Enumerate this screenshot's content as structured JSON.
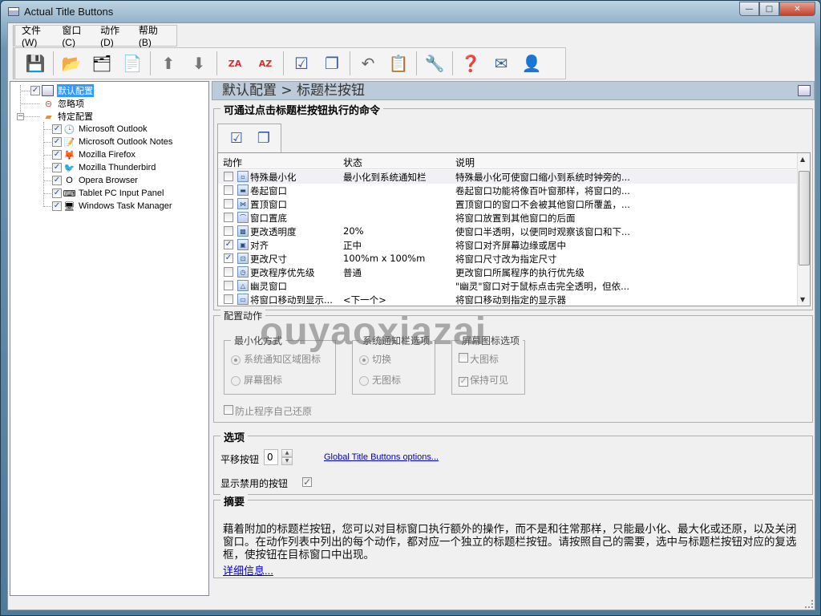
{
  "window": {
    "title": "Actual Title Buttons",
    "controls": {
      "minimize": "—",
      "maximize": "□",
      "close": "✕"
    }
  },
  "menu": [
    {
      "label": "文件(W)"
    },
    {
      "label": "窗口(C)"
    },
    {
      "label": "动作(D)"
    },
    {
      "label": "帮助(B)"
    }
  ],
  "toolbar": [
    {
      "name": "save",
      "icon": "floppy-disk-icon",
      "glyph": "💾"
    },
    {
      "name": "add-window",
      "icon": "add-window-icon",
      "glyph": "📂"
    },
    {
      "name": "remove-window",
      "icon": "remove-window-icon",
      "glyph": "🗂"
    },
    {
      "name": "copy",
      "icon": "copy-icon",
      "glyph": "📄"
    },
    {
      "name": "move-up",
      "icon": "arrow-up-icon",
      "glyph": "⬆"
    },
    {
      "name": "move-down",
      "icon": "arrow-down-icon",
      "glyph": "⬇"
    },
    {
      "name": "sort-za",
      "icon": "sort-za-icon",
      "glyph": "ZA"
    },
    {
      "name": "sort-az",
      "icon": "sort-az-icon",
      "glyph": "AZ"
    },
    {
      "name": "check-all",
      "icon": "check-windows-icon",
      "glyph": "☑"
    },
    {
      "name": "windows",
      "icon": "windows-icon",
      "glyph": "❐"
    },
    {
      "name": "undo",
      "icon": "undo-icon",
      "glyph": "↶"
    },
    {
      "name": "export",
      "icon": "export-icon",
      "glyph": "📋"
    },
    {
      "name": "settings",
      "icon": "tools-icon",
      "glyph": "🔧"
    },
    {
      "name": "help",
      "icon": "help-icon",
      "glyph": "❓"
    },
    {
      "name": "mail",
      "icon": "mail-icon",
      "glyph": "✉"
    },
    {
      "name": "support",
      "icon": "support-icon",
      "glyph": "👤"
    }
  ],
  "tree": {
    "root": [
      {
        "label": "默认配置",
        "checked": true,
        "selected": true
      },
      {
        "label": "忽略项"
      },
      {
        "label": "特定配置",
        "expanded": true
      }
    ],
    "children": [
      {
        "label": "Microsoft Outlook",
        "checked": true,
        "glyph": "🕒"
      },
      {
        "label": "Microsoft Outlook Notes",
        "checked": true,
        "glyph": "📝"
      },
      {
        "label": "Mozilla Firefox",
        "checked": true,
        "glyph": "🦊"
      },
      {
        "label": "Mozilla Thunderbird",
        "checked": true,
        "glyph": "🐦"
      },
      {
        "label": "Opera Browser",
        "checked": true,
        "glyph": "O"
      },
      {
        "label": "Tablet PC Input Panel",
        "checked": true,
        "glyph": "⌨"
      },
      {
        "label": "Windows Task Manager",
        "checked": true,
        "glyph": "🖥"
      }
    ],
    "check_mark": "✓",
    "expander": "−"
  },
  "breadcrumb": "默认配置 > 标题栏按钮",
  "commands": {
    "title": "可通过点击标题栏按钮执行的命令",
    "columns": [
      "动作",
      "状态",
      "说明"
    ],
    "rows": [
      {
        "checked": false,
        "icon": "▫",
        "action": "特殊最小化",
        "status": "最小化到系统通知栏",
        "desc": "特殊最小化可使窗口缩小到系统时钟旁的..."
      },
      {
        "checked": false,
        "icon": "▬",
        "action": "卷起窗口",
        "status": "",
        "desc": "卷起窗口功能将像百叶窗那样，将窗口的..."
      },
      {
        "checked": false,
        "icon": "⋈",
        "action": "置顶窗口",
        "status": "",
        "desc": "置顶窗口的窗口不会被其他窗口所覆盖，..."
      },
      {
        "checked": false,
        "icon": "⌒",
        "action": "窗口置底",
        "status": "",
        "desc": "将窗口放置到其他窗口的后面"
      },
      {
        "checked": false,
        "icon": "▩",
        "action": "更改透明度",
        "status": "20%",
        "desc": "使窗口半透明，以便同时观察该窗口和下..."
      },
      {
        "checked": true,
        "icon": "▣",
        "action": "对齐",
        "status": "正中",
        "desc": "将窗口对齐屏幕边缘或居中"
      },
      {
        "checked": true,
        "icon": "⊡",
        "action": "更改尺寸",
        "status": "100%m x 100%m",
        "desc": "将窗口尺寸改为指定尺寸"
      },
      {
        "checked": false,
        "icon": "◷",
        "action": "更改程序优先级",
        "status": "普通",
        "desc": "更改窗口所属程序的执行优先级"
      },
      {
        "checked": false,
        "icon": "△",
        "action": "幽灵窗口",
        "status": "",
        "desc": "\"幽灵\"窗口对于鼠标点击完全透明，但依..."
      },
      {
        "checked": false,
        "icon": "▭",
        "action": "将窗口移动到显示...",
        "status": "<下一个>",
        "desc": "将窗口移动到指定的显示器"
      }
    ]
  },
  "config": {
    "title": "配置动作",
    "minimize_mode": {
      "title": "最小化方式",
      "options": [
        {
          "label": "系统通知区域图标",
          "selected": true
        },
        {
          "label": "屏幕图标",
          "selected": false
        }
      ]
    },
    "tray_options": {
      "title": "系统通知栏选项",
      "options": [
        {
          "label": "切换",
          "selected": true
        },
        {
          "label": "无图标",
          "selected": false
        }
      ]
    },
    "screen_icon_options": {
      "title": "屏幕图标选项",
      "options": [
        {
          "label": "大图标",
          "checked": false
        },
        {
          "label": "保持可见",
          "checked": true
        }
      ]
    },
    "prevent_restore": {
      "label": "防止程序自己还原",
      "checked": false
    }
  },
  "options": {
    "title": "选项",
    "shift_label": "平移按钮",
    "shift_value": "0",
    "global_link": "Global Title Buttons options...",
    "show_disabled_label": "显示禁用的按钮",
    "show_disabled_checked": true
  },
  "summary": {
    "title": "摘要",
    "text": "藉着附加的标题栏按钮，您可以对目标窗口执行额外的操作，而不是和往常那样，只能最小化、最大化或还原，以及关闭窗口。在动作列表中列出的每个动作，都对应一个独立的标题栏按钮。请按照自己的需要，选中与标题栏按钮对应的复选框，使按钮在目标窗口中出现。",
    "more_link": "详细信息..."
  },
  "watermark": "ouyaoxiazai"
}
